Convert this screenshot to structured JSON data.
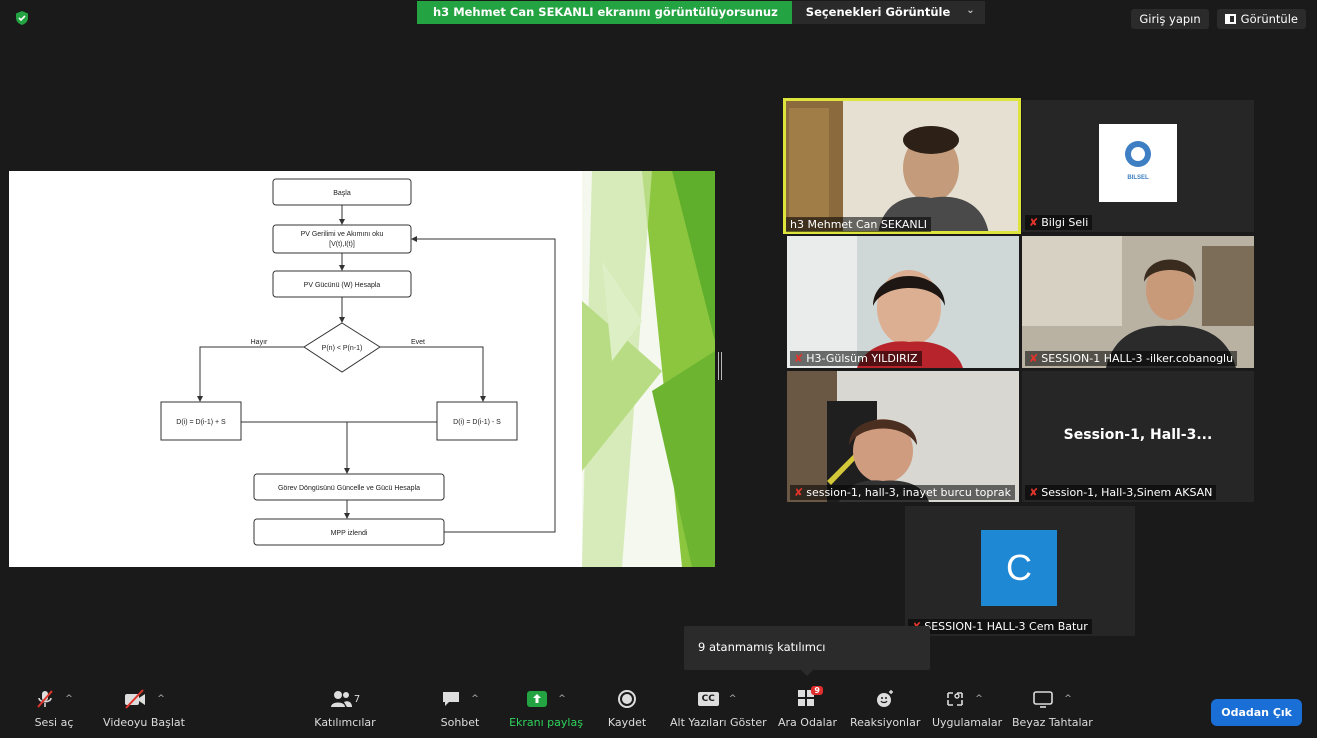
{
  "banner": {
    "sharing_text": "h3 Mehmet Can SEKANLI ekranını görüntülüyorsunuz",
    "options_label": "Seçenekleri Görüntüle"
  },
  "top_right": {
    "sign_in": "Giriş yapın",
    "view": "Görüntüle"
  },
  "flowchart": {
    "start": "Başla",
    "read_pv_1": "PV Gerilimi ve Akımını oku",
    "read_pv_2": "[V(t),I(t)]",
    "calc_power": "PV Gücünü (W) Hesapla",
    "decision": "P(n) < P(n-1)",
    "no_label": "Hayır",
    "yes_label": "Evet",
    "left_box": "D(i) = D(i-1) + S",
    "right_box": "D(i) = D(i-1) - S",
    "update_duty": "Görev Döngüsünü Güncelle ve Gücü Hesapla",
    "mpp": "MPP izlendi"
  },
  "participants": [
    {
      "name": "h3 Mehmet Can SEKANLI"
    },
    {
      "name": "Bilgi Seli"
    },
    {
      "name": "H3-Gülsüm YILDIRIZ"
    },
    {
      "name": "SESSION-1 HALL-3 -ilker.cobanoglu"
    },
    {
      "name": "session-1, hall-3, inayet burcu toprak"
    },
    {
      "name": "Session-1, Hall-3,Sinem AKSAN",
      "big_text": "Session-1,  Hall-3..."
    },
    {
      "name": "SESSION-1 HALL-3 Cem Batur",
      "initial": "C"
    }
  ],
  "logo_text": "BILSEL",
  "tooltip": "9 atanmamış katılımcı",
  "toolbar": {
    "unmute": "Sesi aç",
    "start_video": "Videoyu Başlat",
    "participants": "Katılımcılar",
    "participants_count": "7",
    "chat": "Sohbet",
    "share": "Ekranı paylaş",
    "record": "Kaydet",
    "captions": "Alt Yazıları Göster",
    "captions_icon": "CC",
    "breakout": "Ara Odalar",
    "breakout_badge": "9",
    "reactions": "Reaksiyonlar",
    "apps": "Uygulamalar",
    "whiteboard": "Beyaz Tahtalar",
    "leave": "Odadan Çık"
  },
  "colors": {
    "share_green": "#23a341",
    "active_speaker": "#dde43b",
    "leave_blue": "#1a6fd6",
    "avatar_blue": "#1e88d4"
  }
}
